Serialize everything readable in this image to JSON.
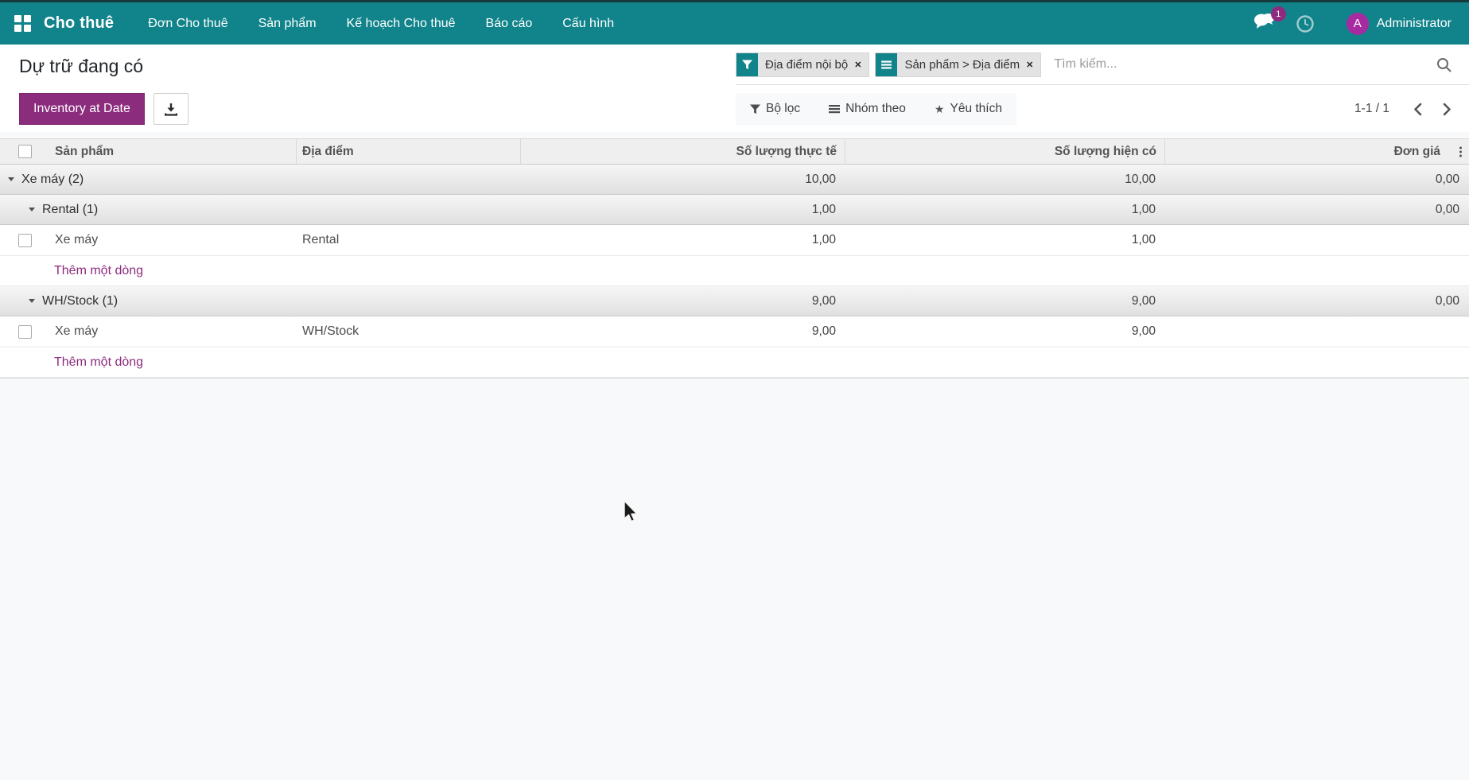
{
  "app": {
    "name": "Cho thuê",
    "menus": [
      "Đơn Cho thuê",
      "Sản phẩm",
      "Kế hoạch Cho thuê",
      "Báo cáo",
      "Cấu hình"
    ],
    "messages_badge": "1",
    "user": {
      "initial": "A",
      "name": "Administrator"
    }
  },
  "page": {
    "title": "Dự trữ đang có",
    "primary_button_label": "Inventory at Date"
  },
  "search": {
    "placeholder": "Tìm kiếm...",
    "facets": [
      {
        "type": "filter",
        "label": "Địa điểm nội bộ"
      },
      {
        "type": "groupby",
        "label": "Sản phẩm > Địa điểm"
      }
    ]
  },
  "controls": {
    "filters_label": "Bộ lọc",
    "groupby_label": "Nhóm theo",
    "favorites_label": "Yêu thích",
    "pager_value": "1-1 / 1"
  },
  "table": {
    "columns": [
      "Sản phẩm",
      "Địa điểm",
      "Số lượng thực tế",
      "Số lượng hiện có",
      "Đơn giá"
    ],
    "add_line_label": "Thêm một dòng",
    "rows": [
      {
        "type": "group",
        "level": 1,
        "label": "Xe máy (2)",
        "qty_real": "10,00",
        "qty_onhand": "10,00",
        "price": "0,00"
      },
      {
        "type": "group",
        "level": 2,
        "label": "Rental (1)",
        "qty_real": "1,00",
        "qty_onhand": "1,00",
        "price": "0,00"
      },
      {
        "type": "data",
        "product": "Xe máy",
        "location": "Rental",
        "qty_real": "1,00",
        "qty_onhand": "1,00",
        "price": ""
      },
      {
        "type": "add"
      },
      {
        "type": "group",
        "level": 2,
        "label": "WH/Stock (1)",
        "qty_real": "9,00",
        "qty_onhand": "9,00",
        "price": "0,00"
      },
      {
        "type": "data",
        "product": "Xe máy",
        "location": "WH/Stock",
        "qty_real": "9,00",
        "qty_onhand": "9,00",
        "price": ""
      },
      {
        "type": "add"
      }
    ]
  },
  "colors": {
    "navbar": "#11838a",
    "primary_button": "#8b2c7d",
    "avatar": "#a62ba0",
    "badge": "#8f2b7f",
    "link": "#8b2c7d"
  }
}
